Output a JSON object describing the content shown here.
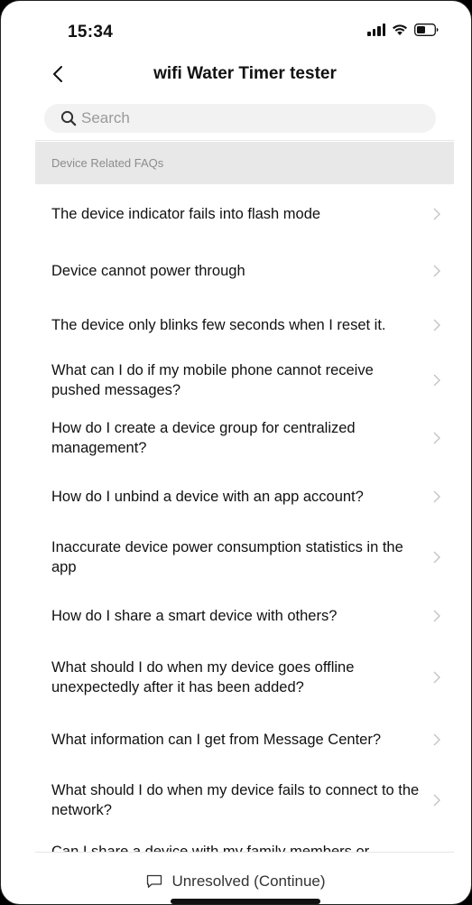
{
  "status_bar": {
    "time": "15:34"
  },
  "header": {
    "title": "wifi Water Timer tester"
  },
  "search": {
    "placeholder": "Search"
  },
  "section": {
    "title": "Device Related FAQs"
  },
  "faqs": [
    "The device indicator fails into flash mode",
    "Device cannot power through",
    "The device only blinks few seconds when I reset it.",
    "What can I do if my mobile phone cannot receive pushed messages?",
    "How do I create a device group for centralized management?",
    "How do I unbind a device with an app account?",
    "Inaccurate device power consumption statistics in the app",
    "How do I share a smart device with others?",
    "What should I do when my device goes offline unexpectedly after it has been added?",
    "What information can I get from Message Center?",
    "What should I do when my device fails to connect to the network?",
    "Can I share a device with my family members or friends?"
  ],
  "footer": {
    "label": "Unresolved (Continue)"
  },
  "colors": {
    "chevron": "#c4c4c4",
    "section_bg": "#e8e8e8",
    "search_bg": "#f2f2f2"
  },
  "icons": [
    "signal-icon",
    "wifi-icon",
    "battery-icon",
    "back-icon",
    "search-icon",
    "chevron-right-icon",
    "chat-bubble-icon"
  ]
}
